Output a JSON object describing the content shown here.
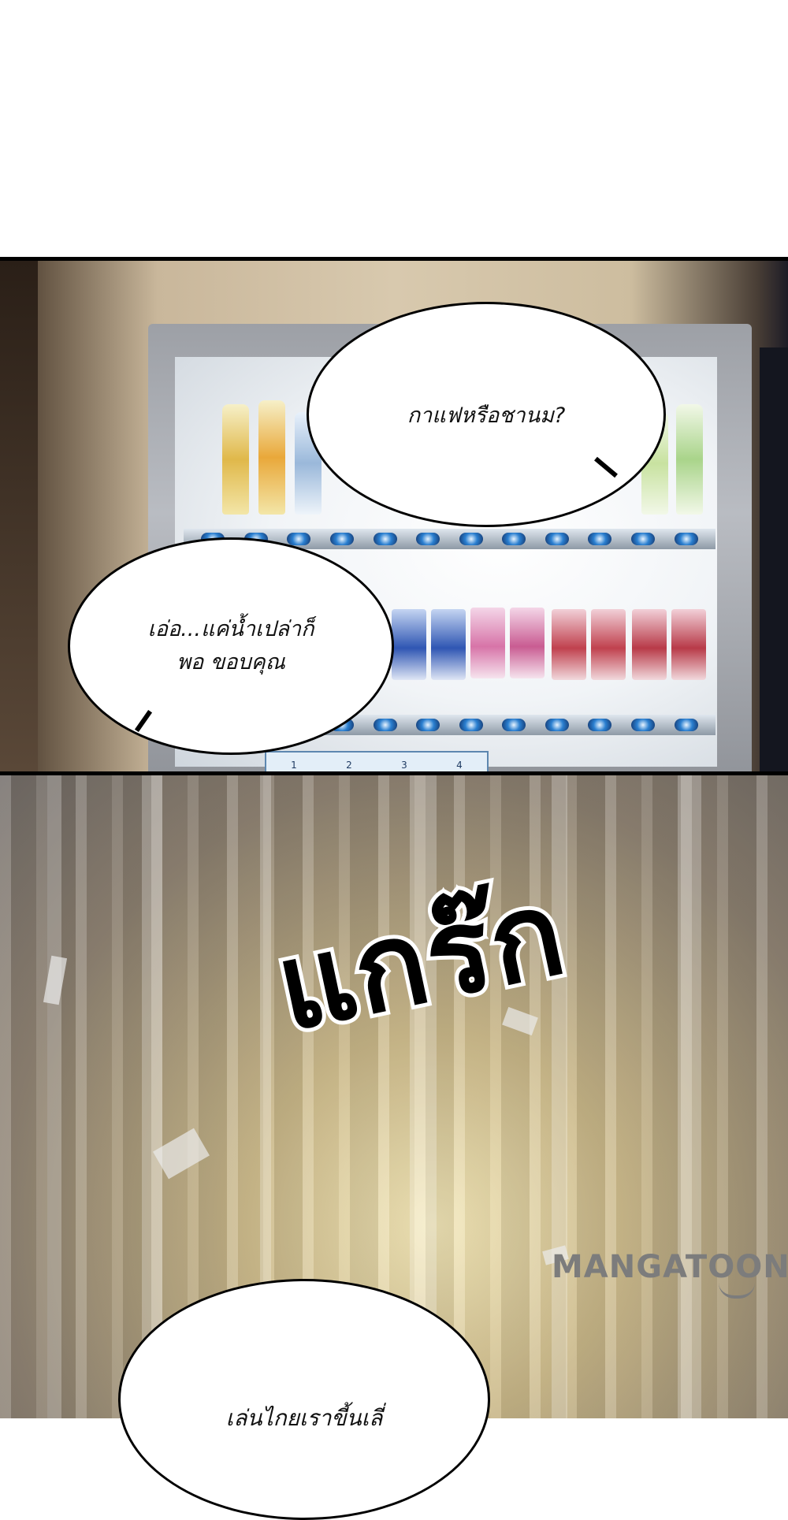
{
  "panel1": {
    "bubble_top": "กาแฟหรือชานม?",
    "bubble_left_line1": "เอ่อ...แค่น้ำเปล่าก็",
    "bubble_left_line2": "พอ ขอบคุณ",
    "vending_panel_labels": [
      "1",
      "2",
      "3",
      "4"
    ]
  },
  "panel2": {
    "sound_effect": "แกร๊ก",
    "watermark": "MANGATOON",
    "bottom_bubble_partial": "เล่นไกยเราขี้นเลี่"
  },
  "colors": {
    "ink": "#000000",
    "watermark": "#7c7c7c",
    "button_blue": "#2a7fd0"
  }
}
